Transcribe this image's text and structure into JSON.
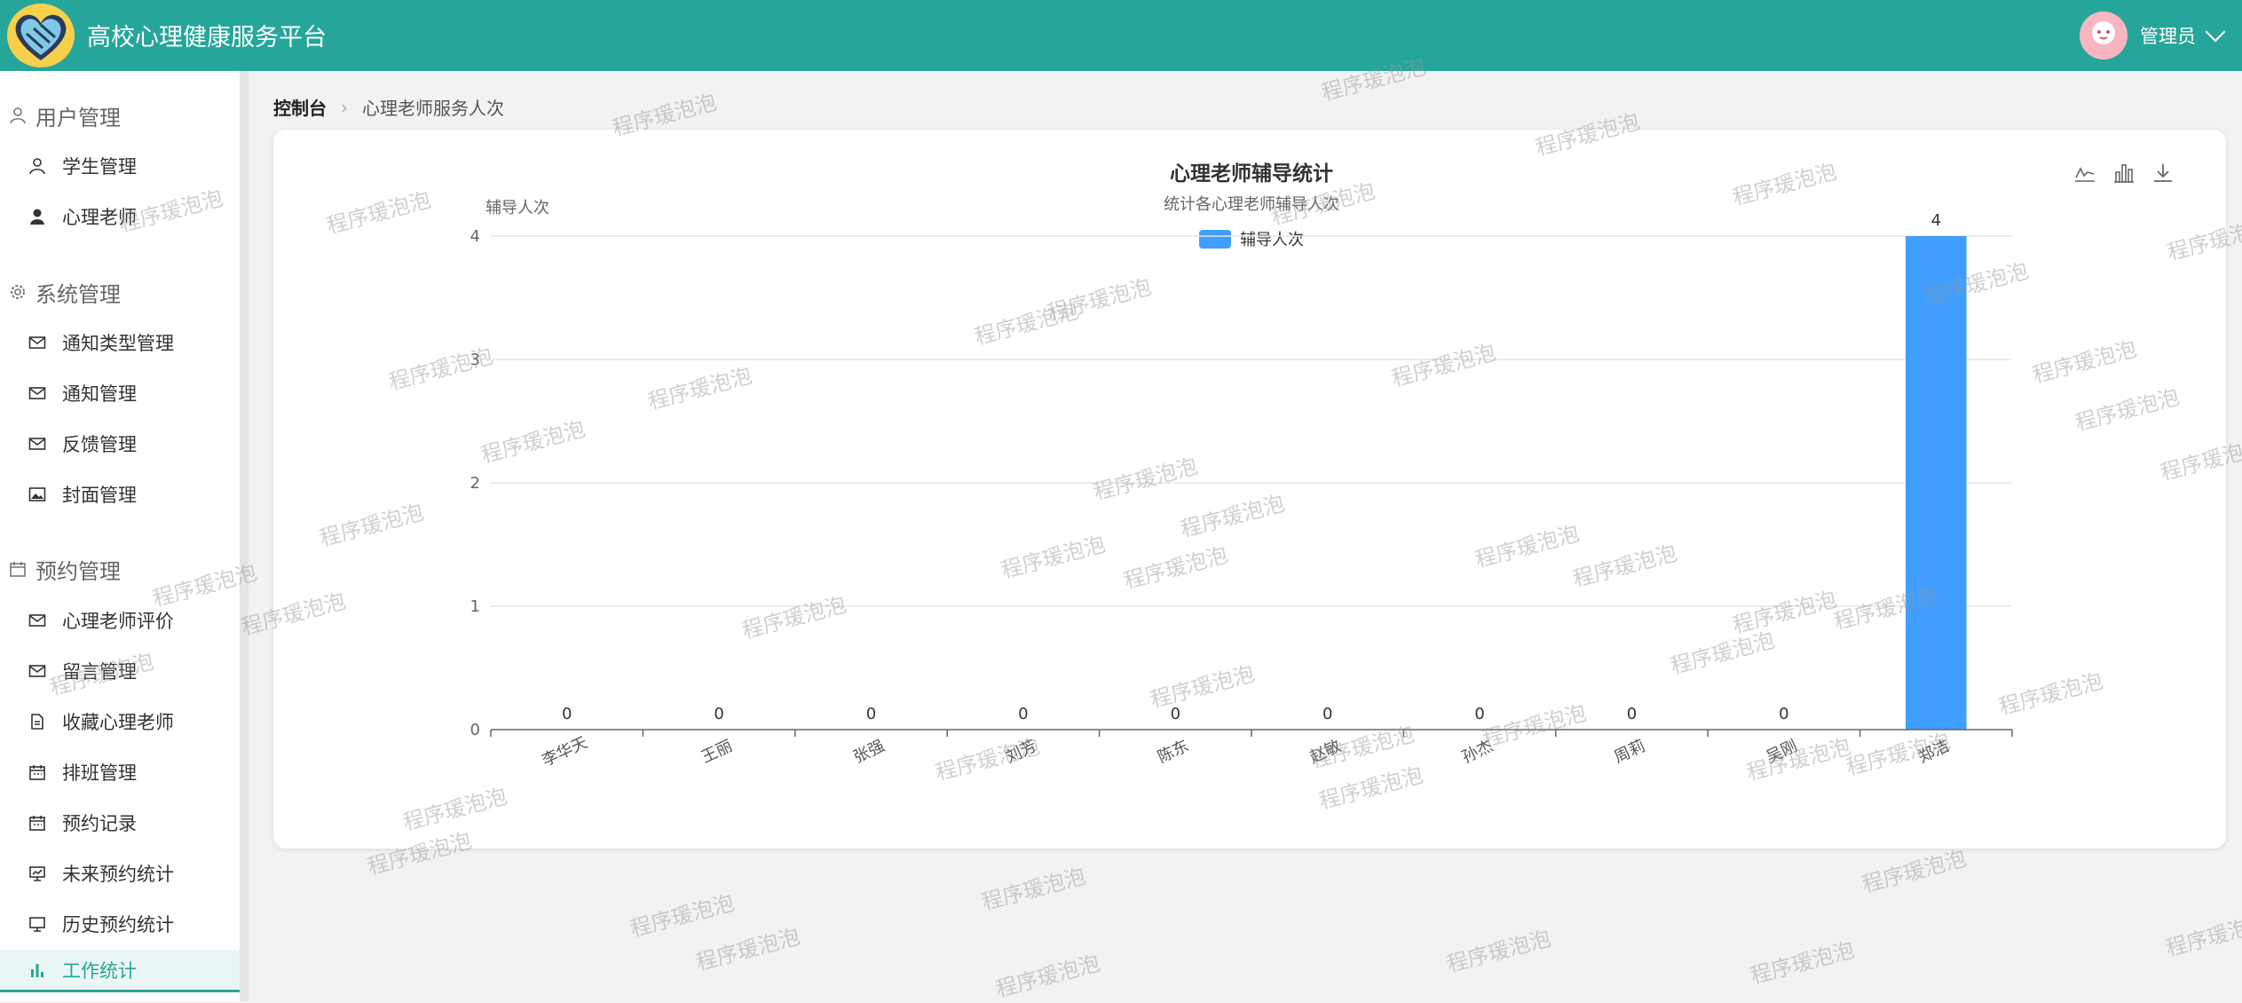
{
  "header": {
    "title": "高校心理健康服务平台",
    "user_label": "管理员"
  },
  "sidebar": {
    "groups": [
      {
        "title": "用户管理",
        "items": [
          "学生管理",
          "心理老师"
        ]
      },
      {
        "title": "系统管理",
        "items": [
          "通知类型管理",
          "通知管理",
          "反馈管理",
          "封面管理"
        ]
      },
      {
        "title": "预约管理",
        "items": [
          "心理老师评价",
          "留言管理",
          "收藏心理老师",
          "排班管理",
          "预约记录",
          "未来预约统计",
          "历史预约统计",
          "工作统计"
        ]
      }
    ]
  },
  "breadcrumb": {
    "home": "控制台",
    "current": "心理老师服务人次"
  },
  "watermark": "程序瑗泡泡",
  "colors": {
    "primary": "#26a69a",
    "bar": "#409eff"
  },
  "chart_data": {
    "type": "bar",
    "title": "心理老师辅导统计",
    "subtitle": "统计各心理老师辅导人次",
    "ylabel": "辅导人次",
    "xlabel": "",
    "categories": [
      "李华天",
      "王丽",
      "张强",
      "刘芳",
      "陈东",
      "赵敏",
      "孙杰",
      "周莉",
      "吴刚",
      "郑洁"
    ],
    "series": [
      {
        "name": "辅导人次",
        "values": [
          0,
          0,
          0,
          0,
          0,
          0,
          0,
          0,
          0,
          4
        ]
      }
    ],
    "ylim": [
      0,
      4
    ],
    "yticks": [
      0,
      1,
      2,
      3,
      4
    ],
    "legend": "top-center",
    "grid": true
  }
}
